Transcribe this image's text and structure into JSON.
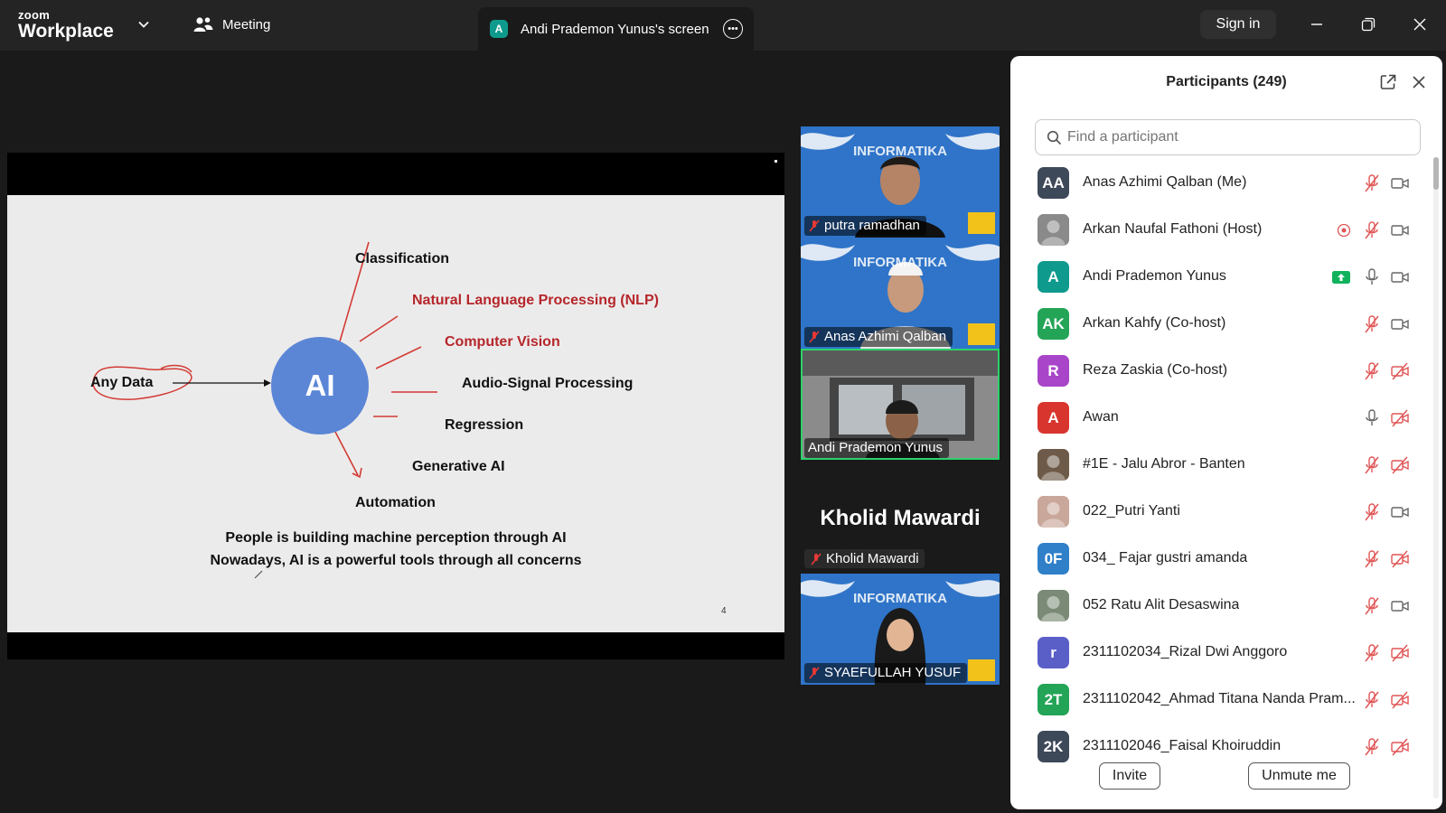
{
  "app": {
    "brand_small": "zoom",
    "brand_big": "Workplace"
  },
  "topbar": {
    "meeting_label": "Meeting",
    "screen_tab_avatar": "A",
    "screen_tab_label": "Andi Prademon Yunus's screen",
    "sign_in": "Sign in"
  },
  "slide": {
    "any_data": "Any Data",
    "ai": "AI",
    "items": [
      "Classification",
      "Natural Language Processing (NLP)",
      "Computer Vision",
      "Audio-Signal Processing",
      "Regression",
      "Generative AI",
      "Automation"
    ],
    "caption_1": "People is building machine perception through AI",
    "caption_2": "Nowadays, AI is a powerful tools through all concerns",
    "page_number": "4",
    "colors": {
      "highlight": "#b6262b",
      "ai_circle": "#5b86d6"
    }
  },
  "video": {
    "tiles": [
      {
        "name": "putra ramadhan"
      },
      {
        "name": "Anas Azhimi Qalban"
      },
      {
        "name": "Andi Prademon Yunus"
      },
      {
        "name": "SYAEFULLAH YUSUF"
      }
    ],
    "banner_text": "INFORMATIKA",
    "active_speaker": "Kholid Mawardi",
    "active_speaker_tag": "Kholid Mawardi"
  },
  "participants": {
    "title": "Participants (249)",
    "search_placeholder": "Find a participant",
    "list": [
      {
        "initials": "AA",
        "name": "Anas Azhimi Qalban (Me)",
        "color": "#3d4858",
        "mic": "muted",
        "video": "on"
      },
      {
        "initials": "",
        "name": "Arkan Naufal Fathoni (Host)",
        "color": "#8a8a8a",
        "mic": "muted",
        "video": "on",
        "recording": true
      },
      {
        "initials": "A",
        "name": "Andi Prademon Yunus",
        "color": "#0e9a8d",
        "mic": "on",
        "video": "on",
        "sharing": true
      },
      {
        "initials": "AK",
        "name": "Arkan Kahfy (Co-host)",
        "color": "#23a456",
        "mic": "muted",
        "video": "on"
      },
      {
        "initials": "R",
        "name": "Reza Zaskia (Co-host)",
        "color": "#a845c8",
        "mic": "muted",
        "video": "off"
      },
      {
        "initials": "A",
        "name": "Awan",
        "color": "#d8352e",
        "mic": "on",
        "video": "off"
      },
      {
        "initials": "",
        "name": "#1E - Jalu Abror - Banten",
        "color": "#6e5a48",
        "mic": "muted",
        "video": "off"
      },
      {
        "initials": "",
        "name": "022_Putri Yanti",
        "color": "#c9a79a",
        "mic": "muted",
        "video": "on"
      },
      {
        "initials": "0F",
        "name": "034_ Fajar gustri amanda",
        "color": "#2f7fc9",
        "mic": "muted",
        "video": "off"
      },
      {
        "initials": "",
        "name": "052 Ratu Alit Desaswina",
        "color": "#7b8a77",
        "mic": "muted",
        "video": "on"
      },
      {
        "initials": "r",
        "name": "2311102034_Rizal Dwi Anggoro",
        "color": "#5a5fc8",
        "mic": "muted",
        "video": "off"
      },
      {
        "initials": "2T",
        "name": "2311102042_Ahmad Titana Nanda Pram...",
        "color": "#23a456",
        "mic": "muted",
        "video": "off"
      },
      {
        "initials": "2K",
        "name": "2311102046_Faisal Khoiruddin",
        "color": "#3d4858",
        "mic": "muted",
        "video": "off"
      }
    ],
    "invite": "Invite",
    "unmute_me": "Unmute me"
  }
}
